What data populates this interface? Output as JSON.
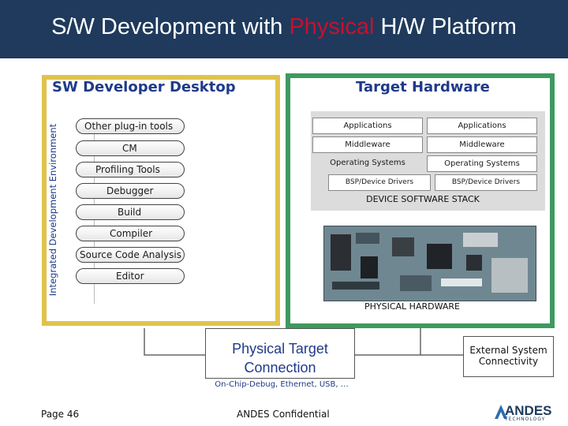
{
  "header": {
    "title_prefix": "S/W Development with ",
    "title_highlight": "Physical",
    "title_suffix": " H/W Platform"
  },
  "sw": {
    "title": "SW Developer Desktop",
    "ide_label": "Integrated Development Environment",
    "tools": [
      "Other plug-in tools",
      "CM",
      "Profiling Tools",
      "Debugger",
      "Build",
      "Compiler",
      "Source Code Analysis",
      "Editor"
    ]
  },
  "hw": {
    "title": "Target Hardware",
    "stack": {
      "left": [
        "Applications",
        "Middleware",
        "Operating Systems",
        "BSP/Device Drivers"
      ],
      "right": [
        "Applications",
        "Middleware",
        "Operating Systems",
        "BSP/Device Drivers"
      ],
      "caption": "DEVICE SOFTWARE STACK"
    },
    "physical_caption": "PHYSICAL HARDWARE"
  },
  "connection": {
    "title": "Physical Target Connection",
    "subtitle": "On-Chip-Debug, Ethernet, USB, …"
  },
  "external": {
    "label": "External System Connectivity"
  },
  "footer": {
    "page": "Page 46",
    "confidential": "ANDES Confidential",
    "logo_text": "ANDES",
    "logo_sub": "TECHNOLOGY"
  },
  "colors": {
    "header_bg": "#1f3a5c",
    "highlight": "#c8102e",
    "sw_border": "#e0c34b",
    "hw_border": "#3e9a5e",
    "title_blue": "#1f3a8a"
  }
}
